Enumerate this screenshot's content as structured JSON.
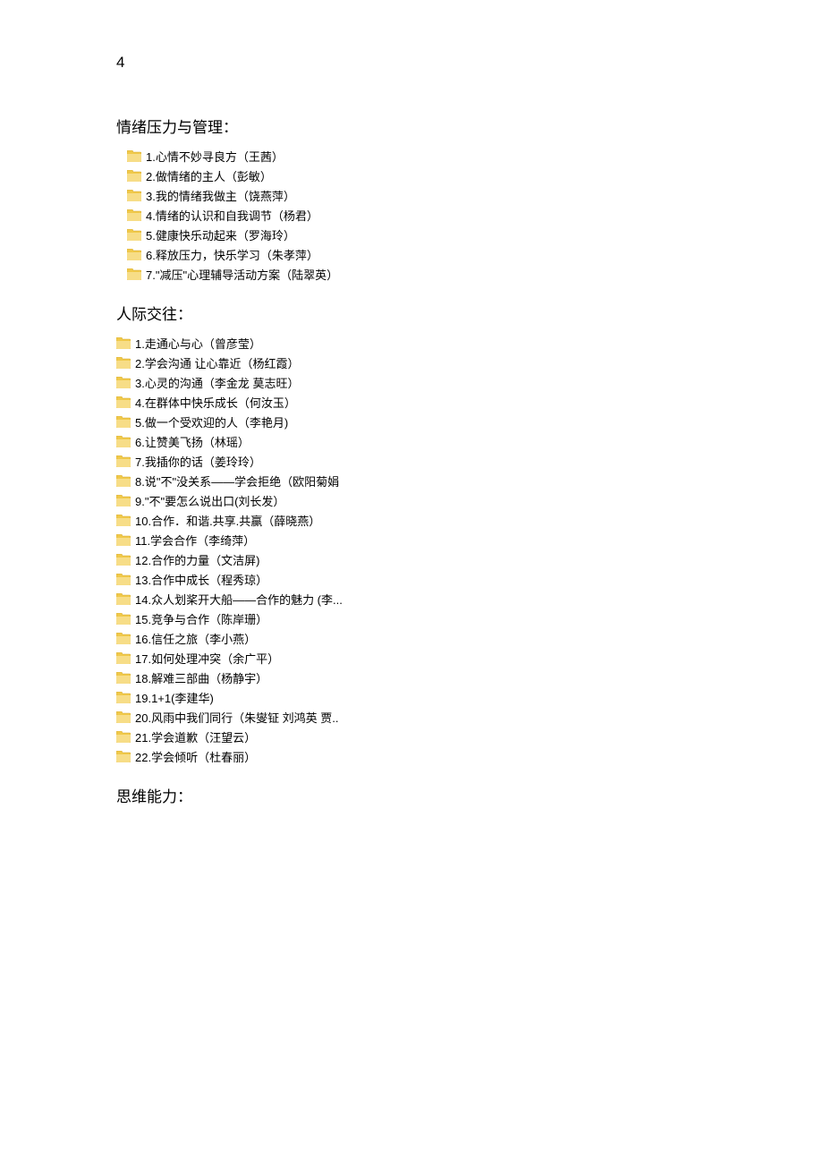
{
  "page_number": "4",
  "sections": [
    {
      "title": "情绪压力与管理：",
      "indent": true,
      "items": [
        "1.心情不妙寻良方（王茜）",
        "2.做情绪的主人（彭敏）",
        "3.我的情绪我做主（饶燕萍）",
        "4.情绪的认识和自我调节（杨君）",
        "5.健康快乐动起来（罗海玲）",
        "6.释放压力，快乐学习（朱孝萍）",
        "7.\"减压\"心理辅导活动方案（陆翠英）"
      ]
    },
    {
      "title": "人际交往：",
      "indent": false,
      "items": [
        "1.走通心与心（曾彦莹）",
        "2.学会沟通 让心靠近（杨红霞）",
        "3.心灵的沟通（李金龙  莫志旺）",
        "4.在群体中快乐成长（何汝玉）",
        "5.做一个受欢迎的人（李艳月)",
        "6.让赞美飞扬（林瑶）",
        "7.我插你的话（姜玲玲）",
        "8.说\"不\"没关系——学会拒绝（欧阳菊娟",
        "9.\"不\"要怎么说出口(刘长发）",
        "10.合作．和谐.共享.共赢（薛晓燕）",
        "11.学会合作（李绮萍）",
        "12.合作的力量（文洁屏)",
        "13.合作中成长（程秀琼）",
        "14.众人划桨开大船——合作的魅力 (李...",
        "15.竞争与合作（陈岸珊）",
        "16.信任之旅（李小燕）",
        "17.如何处理冲突（余广平）",
        "18.解难三部曲（杨静宇）",
        "19.1+1(李建华)",
        "20.风雨中我们同行（朱燮钲  刘鸿英  贾..",
        "21.学会道歉（汪望云）",
        "22.学会倾听（杜春丽）"
      ]
    },
    {
      "title": "思维能力：",
      "indent": false,
      "items": []
    }
  ]
}
